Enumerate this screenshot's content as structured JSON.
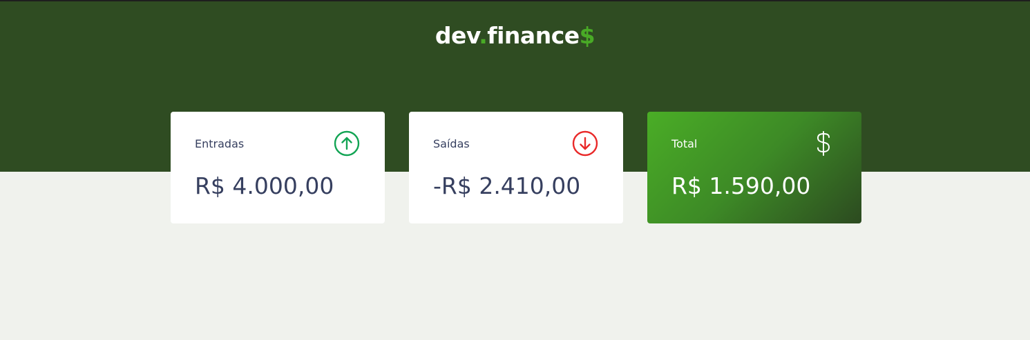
{
  "header": {
    "logo": {
      "part1": "dev",
      "dot": ".",
      "part2": "finance",
      "dollar": "$"
    }
  },
  "cards": [
    {
      "label": "Entradas",
      "value": "R$ 4.000,00",
      "icon": "arrow-up-circle-icon",
      "color": "#12a454"
    },
    {
      "label": "Saídas",
      "value": "-R$ 2.410,00",
      "icon": "arrow-down-circle-icon",
      "color": "#e92929"
    },
    {
      "label": "Total",
      "value": "R$ 1.590,00",
      "icon": "dollar-sign-icon",
      "color": "#ffffff"
    }
  ],
  "colors": {
    "header_bg": "#2f4c22",
    "accent": "#49aa26",
    "page_bg": "#f0f2ed",
    "text": "#363f5f"
  }
}
